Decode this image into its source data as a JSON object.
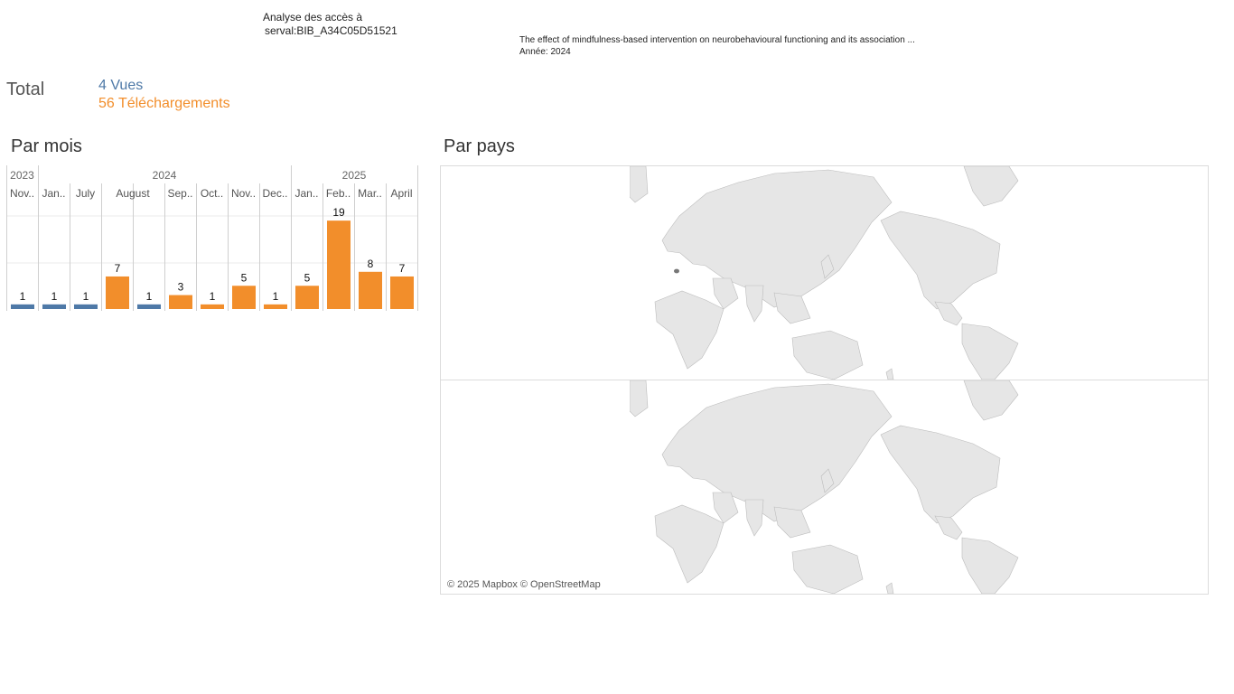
{
  "header": {
    "analysis_line1": "Analyse des accès à",
    "analysis_line2": "serval:BIB_A34C05D51521",
    "doc_title": "The effect of mindfulness-based intervention on neurobehavioural functioning and its association ...",
    "doc_year": "Année: 2024"
  },
  "totals": {
    "label": "Total",
    "views": "4 Vues",
    "downloads": "56 Téléchargements"
  },
  "sections": {
    "by_month": "Par mois",
    "by_country": "Par pays"
  },
  "colors": {
    "views": "#4e79a7",
    "downloads": "#f28e2b",
    "gridline": "#ebebeb",
    "divider": "#cfcfcf",
    "land": "#e6e6e6",
    "border": "#bcbcbc",
    "highlight": "#777777"
  },
  "chart_data": {
    "type": "bar",
    "years": [
      {
        "label": "2023",
        "span": 1
      },
      {
        "label": "2024",
        "span": 8
      },
      {
        "label": "2025",
        "span": 4
      }
    ],
    "categories": [
      "Nov..",
      "Jan..",
      "July",
      "August",
      "Sep..",
      "Oct..",
      "Nov..",
      "Dec..",
      "Jan..",
      "Feb..",
      "Mar..",
      "April"
    ],
    "category_years": [
      "2023",
      "2024",
      "2024",
      "2024",
      "2024",
      "2024",
      "2024",
      "2024",
      "2025",
      "2025",
      "2025",
      "2025"
    ],
    "values": [
      1,
      1,
      1,
      7,
      1,
      3,
      1,
      5,
      1,
      5,
      19,
      8,
      7
    ],
    "bars": [
      {
        "value": 1,
        "type": "views"
      },
      {
        "value": 1,
        "type": "views"
      },
      {
        "value": 1,
        "type": "views"
      },
      {
        "value": 7,
        "type": "downloads"
      },
      {
        "value": 1,
        "type": "views"
      },
      {
        "value": 3,
        "type": "downloads"
      },
      {
        "value": 1,
        "type": "downloads"
      },
      {
        "value": 5,
        "type": "downloads"
      },
      {
        "value": 1,
        "type": "downloads"
      },
      {
        "value": 5,
        "type": "downloads"
      },
      {
        "value": 19,
        "type": "downloads"
      },
      {
        "value": 8,
        "type": "downloads"
      },
      {
        "value": 7,
        "type": "downloads"
      }
    ],
    "ylim": [
      0,
      20
    ],
    "grid": true
  },
  "map": {
    "attribution": "© 2025 Mapbox © OpenStreetMap",
    "panels": [
      "views",
      "downloads"
    ],
    "highlighted_country": "Switzerland"
  }
}
